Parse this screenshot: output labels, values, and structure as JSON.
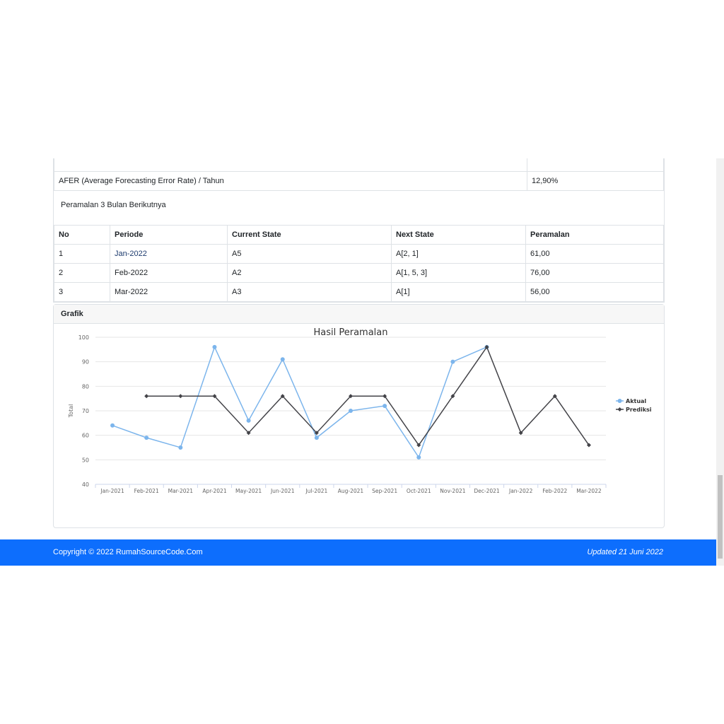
{
  "afer": {
    "label": "AFER (Average Forecasting Error Rate) / Tahun",
    "value": "12,90%"
  },
  "forecast_title": "Peramalan 3 Bulan Berikutnya",
  "table": {
    "headers": [
      "No",
      "Periode",
      "Current State",
      "Next State",
      "Peramalan"
    ],
    "rows": [
      [
        "1",
        "Jan-2022",
        "A5",
        "A[2, 1]",
        "61,00"
      ],
      [
        "2",
        "Feb-2022",
        "A2",
        "A[1, 5, 3]",
        "76,00"
      ],
      [
        "3",
        "Mar-2022",
        "A3",
        "A[1]",
        "56,00"
      ]
    ]
  },
  "grafik_title": "Grafik",
  "chart_data": {
    "type": "line",
    "title": "Hasil Peramalan",
    "ylabel": "Total",
    "xlabel": "",
    "ylim": [
      40,
      100
    ],
    "yticks": [
      40,
      50,
      60,
      70,
      80,
      90,
      100
    ],
    "categories": [
      "Jan-2021",
      "Feb-2021",
      "Mar-2021",
      "Apr-2021",
      "May-2021",
      "Jun-2021",
      "Jul-2021",
      "Aug-2021",
      "Sep-2021",
      "Oct-2021",
      "Nov-2021",
      "Dec-2021",
      "Jan-2022",
      "Feb-2022",
      "Mar-2022"
    ],
    "series": [
      {
        "name": "Aktual",
        "color": "#7cb5ec",
        "values": [
          64,
          59,
          55,
          96,
          66,
          91,
          59,
          70,
          72,
          51,
          90,
          96,
          null,
          null,
          null
        ]
      },
      {
        "name": "Prediksi",
        "color": "#434348",
        "values": [
          null,
          76,
          76,
          76,
          61,
          76,
          61,
          76,
          76,
          56,
          76,
          96,
          61,
          76,
          56
        ]
      }
    ],
    "legend": "right"
  },
  "footer": {
    "copyright": "Copyright © 2022 RumahSourceCode.Com",
    "updated": "Updated 21 Juni 2022"
  }
}
